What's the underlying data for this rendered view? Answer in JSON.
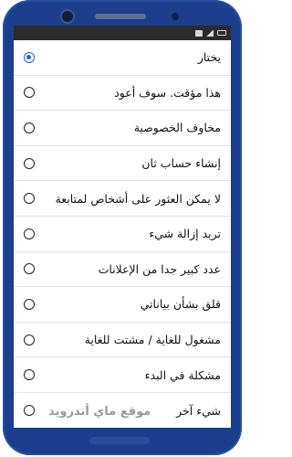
{
  "report_dialog": {
    "options": [
      {
        "label": "يختار",
        "selected": true
      },
      {
        "label": "هذا مؤقت. سوف أعود",
        "selected": false
      },
      {
        "label": "مخاوف الخصوصية",
        "selected": false
      },
      {
        "label": "إنشاء حساب ثان",
        "selected": false
      },
      {
        "label": "لا يمكن العثور على أشخاص لمتابعة",
        "selected": false
      },
      {
        "label": "تريد إزالة شيء",
        "selected": false
      },
      {
        "label": "عدد كبير جدا من الإعلانات",
        "selected": false
      },
      {
        "label": "قلق بشأن بياناتي",
        "selected": false
      },
      {
        "label": "مشغول للغاية / مشتت للغاية",
        "selected": false
      },
      {
        "label": "مشكلة في البدء",
        "selected": false
      },
      {
        "label": "شيء آخر",
        "selected": false
      }
    ]
  },
  "watermark": "موقع ماي أندرويد",
  "colors": {
    "phone_body": "#1b3f8c",
    "radio_selected": "#1e67d4",
    "status_bar": "#2b2b2b"
  }
}
